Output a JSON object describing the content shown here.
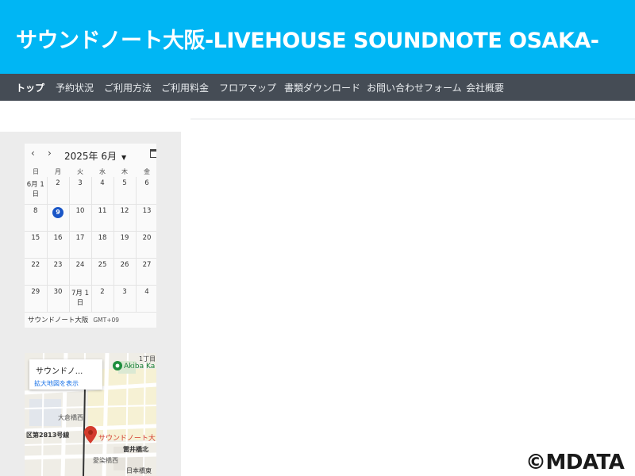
{
  "header": {
    "site_title": "サウンドノート大阪-LIVEHOUSE SOUNDNOTE OSAKA-",
    "bg_color": "#00b6f4"
  },
  "nav": {
    "bg_color": "#454c55",
    "items": [
      {
        "label": "トップ",
        "active": true
      },
      {
        "label": "予約状況"
      },
      {
        "label": "ご利用方法"
      },
      {
        "label": "ご利用料金"
      },
      {
        "label": "フロアマップ"
      },
      {
        "label": "書類ダウンロード"
      },
      {
        "label": "お問い合わせフォーム"
      },
      {
        "label": "会社概要"
      }
    ]
  },
  "calendar": {
    "prev_icon": "chevron-left-icon",
    "next_icon": "chevron-right-icon",
    "month_label": "2025年 6月",
    "weekdays": [
      "日",
      "月",
      "火",
      "水",
      "木",
      "金"
    ],
    "weeks": [
      [
        "6月 1日",
        "2",
        "3",
        "4",
        "5",
        "6"
      ],
      [
        "8",
        "9",
        "10",
        "11",
        "12",
        "13"
      ],
      [
        "15",
        "16",
        "17",
        "18",
        "19",
        "20"
      ],
      [
        "22",
        "23",
        "24",
        "25",
        "26",
        "27"
      ],
      [
        "29",
        "30",
        "7月 1日",
        "2",
        "3",
        "4"
      ]
    ],
    "today": "9",
    "today_color": "#1a56c7",
    "calendar_name": "サウンドノート大阪",
    "timezone": "GMT+09"
  },
  "map": {
    "card_title": "サウンドノ...",
    "card_link": "拡大地図を表示",
    "poi_label": "Akiba Ka",
    "pin_label": "サウンドノート大",
    "street_labels": [
      "1丁目",
      "大倉橋西",
      "区第2813号線",
      "雷井橋北",
      "愛染橋西",
      "日本橋東"
    ],
    "pin_color": "#d33b2c"
  },
  "watermark": "©MDATA"
}
